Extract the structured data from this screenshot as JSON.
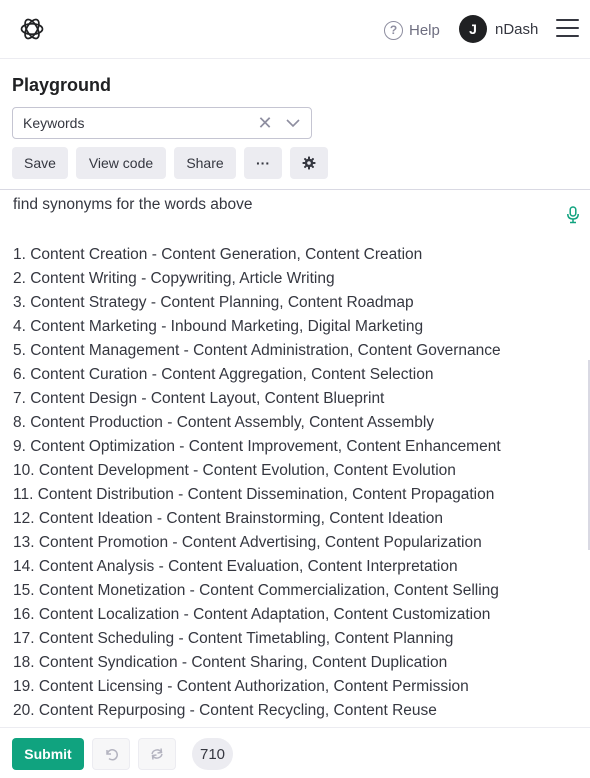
{
  "header": {
    "help_label": "Help",
    "user_initial": "J",
    "user_name": "nDash"
  },
  "page": {
    "title": "Playground"
  },
  "preset": {
    "value": "Keywords"
  },
  "toolbar": {
    "save_label": "Save",
    "view_code_label": "View code",
    "share_label": "Share",
    "more_label": "···"
  },
  "editor": {
    "prompt": "find synonyms for the words above",
    "results": [
      "1. Content Creation - Content Generation, Content Creation",
      "2. Content Writing - Copywriting, Article Writing",
      "3. Content Strategy - Content Planning, Content Roadmap",
      "4. Content Marketing - Inbound Marketing, Digital Marketing",
      "5. Content Management - Content Administration, Content Governance",
      "6. Content Curation - Content Aggregation, Content Selection",
      "7. Content Design - Content Layout, Content Blueprint",
      "8. Content Production - Content Assembly, Content Assembly",
      "9. Content Optimization - Content Improvement, Content Enhancement",
      "10. Content Development - Content Evolution, Content Evolution",
      "11. Content Distribution - Content Dissemination, Content Propagation",
      "12. Content Ideation - Content Brainstorming, Content Ideation",
      "13. Content Promotion - Content Advertising, Content Popularization",
      "14. Content Analysis - Content Evaluation, Content Interpretation",
      "15. Content Monetization - Content Commercialization, Content Selling",
      "16. Content Localization - Content Adaptation, Content Customization",
      "17. Content Scheduling - Content Timetabling, Content Planning",
      "18. Content Syndication - Content Sharing, Content Duplication",
      "19. Content Licensing - Content Authorization, Content Permission",
      "20. Content Repurposing - Content Recycling, Content Reuse"
    ]
  },
  "footer": {
    "submit_label": "Submit",
    "token_count": "710"
  },
  "colors": {
    "accent": "#10a37f",
    "button_bg": "#ececf1",
    "text": "#353740"
  },
  "icons": {
    "logo": "openai-logo-icon",
    "help": "help-circle-icon",
    "menu": "hamburger-menu-icon",
    "clear": "close-icon",
    "dropdown": "chevron-down-icon",
    "settings": "gear-icon",
    "mic": "microphone-icon",
    "undo": "undo-icon",
    "redo": "redo-icon"
  }
}
